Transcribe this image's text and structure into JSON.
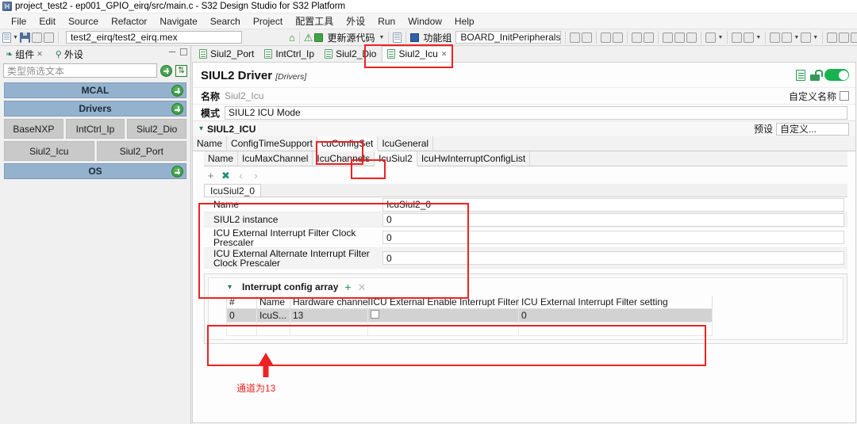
{
  "window": {
    "title": "project_test2 - ep001_GPIO_eirq/src/main.c - S32 Design Studio for S32 Platform",
    "app_icon": "s32ds-icon"
  },
  "menubar": {
    "items": [
      {
        "label": "File"
      },
      {
        "label": "Edit"
      },
      {
        "label": "Source"
      },
      {
        "label": "Refactor"
      },
      {
        "label": "Navigate"
      },
      {
        "label": "Search"
      },
      {
        "label": "Project"
      },
      {
        "label": "配置工具"
      },
      {
        "label": "外设"
      },
      {
        "label": "Run"
      },
      {
        "label": "Window"
      },
      {
        "label": "Help"
      }
    ]
  },
  "toolbar": {
    "mex_path": "test2_eirq/test2_eirq.mex",
    "update_source_label": "更新源代码",
    "functional_group_label": "功能组",
    "board_value": "BOARD_InitPeripherals",
    "icons": [
      "new-file-icon",
      "save-icon",
      "save-all-icon",
      "save-as-icon",
      "home-icon",
      "warning-icon",
      "update-source-icon",
      "copy-icon",
      "functional-group-icon"
    ]
  },
  "left_panel": {
    "tabs": [
      {
        "label": "组件",
        "icon": "components-icon",
        "active": true,
        "closable": true
      },
      {
        "label": "外设",
        "icon": "peripherals-icon",
        "active": false,
        "closable": false
      }
    ],
    "filter_placeholder": "类型筛选文本",
    "filter_value": "",
    "add_button": "add-component-button",
    "sort_button": "sort-button",
    "groups": [
      {
        "name": "MCAL",
        "components": []
      },
      {
        "name": "Drivers",
        "components": [
          [
            "BaseNXP",
            "IntCtrl_Ip",
            "Siul2_Dio"
          ],
          [
            "Siul2_Icu",
            "Siul2_Port"
          ]
        ]
      },
      {
        "name": "OS",
        "components": []
      }
    ]
  },
  "editor": {
    "tabs": [
      {
        "label": "Siul2_Port",
        "active": false,
        "closable": false
      },
      {
        "label": "IntCtrl_Ip",
        "active": false,
        "closable": false
      },
      {
        "label": "Siul2_Dio",
        "active": false,
        "closable": false
      },
      {
        "label": "Siul2_Icu",
        "active": true,
        "closable": true
      }
    ],
    "header": {
      "title": "SIUL2 Driver",
      "subtitle": "[Drivers]",
      "name_label": "名称",
      "name_value": "Siul2_Icu",
      "mode_label": "模式",
      "mode_value": "SIUL2 ICU Mode",
      "custom_name_label": "自定义名称",
      "custom_name_checked": false,
      "toggle_on": true
    },
    "section": {
      "title": "SIUL2_ICU",
      "preset_label": "预设",
      "preset_value": "自定义..."
    },
    "tabstrip_level1": [
      {
        "label": "Name",
        "active": false
      },
      {
        "label": "ConfigTimeSupport",
        "active": false
      },
      {
        "label": "cuConfigSet",
        "active": true
      },
      {
        "label": "IcuGeneral",
        "active": false
      }
    ],
    "tabstrip_level2": [
      {
        "label": "Name",
        "active": false
      },
      {
        "label": "IcuMaxChannel",
        "active": false
      },
      {
        "label": "IcuChannels",
        "active": false
      },
      {
        "label": "IcuSiul2",
        "active": true
      },
      {
        "label": "IcuHwInterruptConfigList",
        "active": false
      }
    ],
    "array_toolbar": {
      "add": "+",
      "remove": "✖",
      "prev": "‹",
      "next": "›"
    },
    "subtab": "IcuSiul2_0",
    "properties": [
      {
        "label": "Name",
        "value": "IcuSiul2_0"
      },
      {
        "label": "SIUL2 instance",
        "value": "0"
      },
      {
        "label": "ICU External Interrupt Filter Clock Prescaler",
        "value": "0"
      },
      {
        "label": "ICU External Alternate Interrupt Filter Clock Prescaler",
        "value": "0"
      }
    ],
    "interrupt_config_array": {
      "title": "Interrupt config array",
      "add": "+",
      "remove": "✕",
      "columns": [
        "#",
        "Name",
        "Hardware channel",
        "ICU External Enable Interrupt Filter",
        "ICU External Interrupt Filter setting"
      ],
      "rows": [
        {
          "index": "0",
          "name": "IcuS...",
          "hardware_channel": "13",
          "enable_filter": false,
          "filter_setting": "0",
          "selected": true
        }
      ]
    }
  },
  "annotations": {
    "channel_note": "通道为13",
    "color": "#ee2222",
    "boxes": [
      {
        "name": "tab-siul2-icu-highlight"
      },
      {
        "name": "cuconfigset-tab-highlight"
      },
      {
        "name": "icusiul2-tab-highlight"
      },
      {
        "name": "icusiul2-panel-highlight"
      },
      {
        "name": "interrupt-config-table-highlight"
      }
    ]
  }
}
